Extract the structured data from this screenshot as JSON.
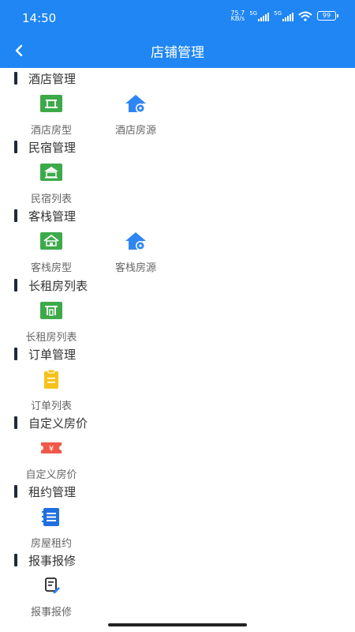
{
  "status": {
    "time": "14:50",
    "net_speed_value": "75.7",
    "net_speed_unit": "KB/s",
    "signal1": "5G",
    "signal2": "5G",
    "battery": "99"
  },
  "header": {
    "title": "店铺管理"
  },
  "sections": [
    {
      "title": "酒店管理",
      "items": [
        {
          "label": "酒店房型",
          "icon": "room-type-icon"
        },
        {
          "label": "酒店房源",
          "icon": "house-settings-icon"
        }
      ]
    },
    {
      "title": "民宿管理",
      "items": [
        {
          "label": "民宿列表",
          "icon": "homestay-icon"
        }
      ]
    },
    {
      "title": "客栈管理",
      "items": [
        {
          "label": "客栈房型",
          "icon": "inn-icon"
        },
        {
          "label": "客栈房源",
          "icon": "house-settings-icon"
        }
      ]
    },
    {
      "title": "长租房列表",
      "items": [
        {
          "label": "长租房列表",
          "icon": "long-rent-icon"
        }
      ]
    },
    {
      "title": "订单管理",
      "items": [
        {
          "label": "订单列表",
          "icon": "clipboard-icon"
        }
      ]
    },
    {
      "title": "自定义房价",
      "items": [
        {
          "label": "自定义房价",
          "icon": "price-ticket-icon"
        }
      ]
    },
    {
      "title": "租约管理",
      "items": [
        {
          "label": "房屋租约",
          "icon": "contract-icon"
        }
      ]
    },
    {
      "title": "报事报修",
      "items": [
        {
          "label": "报事报修",
          "icon": "repair-report-icon"
        }
      ]
    }
  ],
  "colors": {
    "header": "#1f86f4",
    "green": "#3daa4a",
    "blue": "#2f86f3",
    "yellow": "#f5c21b",
    "red": "#f0594a"
  }
}
